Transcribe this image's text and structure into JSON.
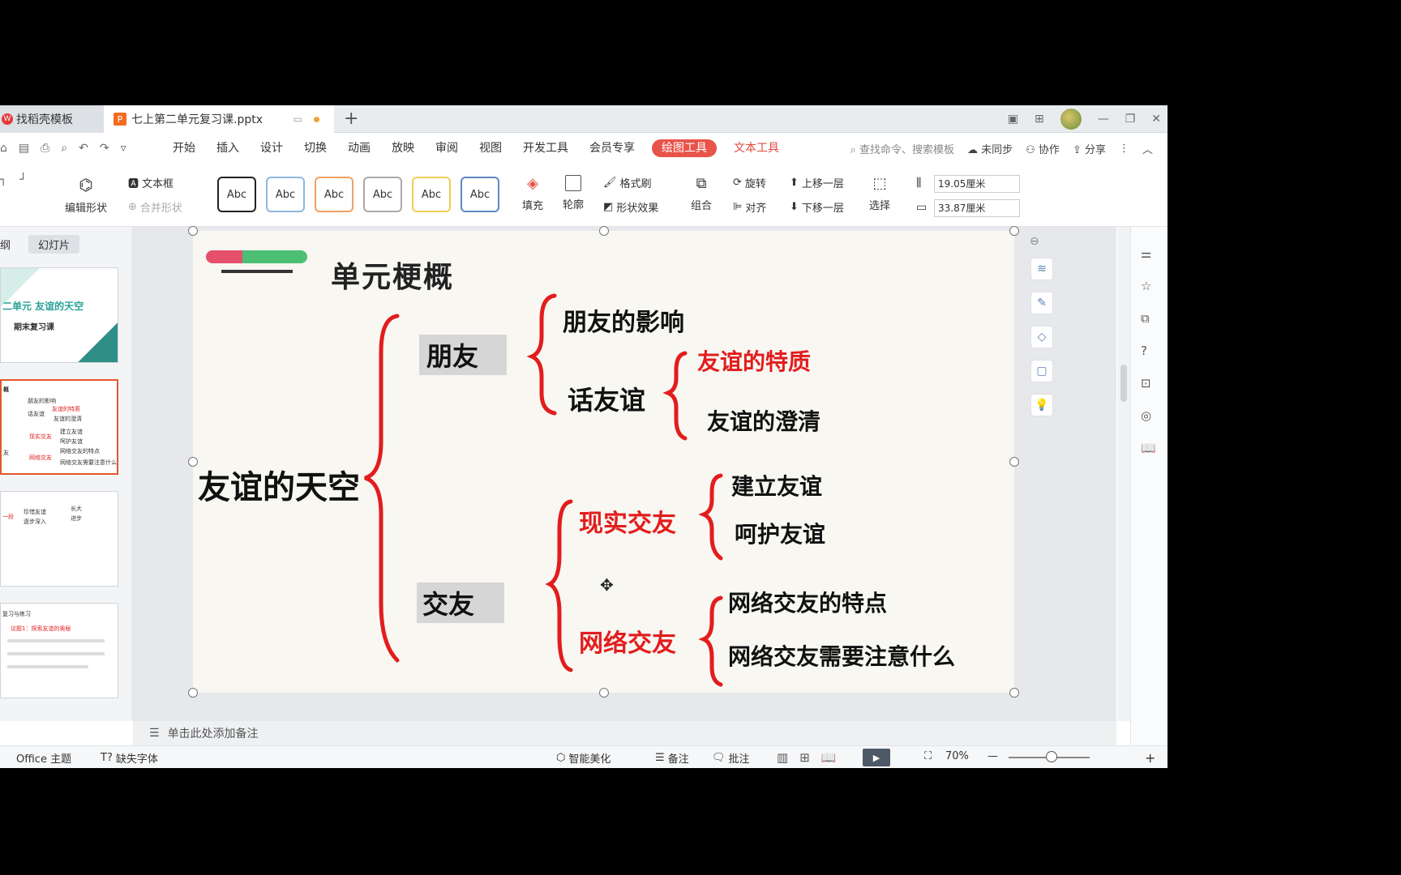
{
  "tabs": {
    "inactive_label": "找稻壳模板",
    "active_label": "七上第二单元复习课.pptx",
    "new_tab": "+"
  },
  "menu": {
    "items": [
      "开始",
      "插入",
      "设计",
      "切换",
      "动画",
      "放映",
      "审阅",
      "视图",
      "开发工具",
      "会员专享"
    ],
    "drawing_tools": "绘图工具",
    "text_tools": "文本工具",
    "search": "查找命令、搜索模板",
    "sync": "未同步",
    "collab": "协作",
    "share": "分享"
  },
  "ribbon": {
    "edit_shape": "编辑形状",
    "text_box": "文本框",
    "merge_shape": "合并形状",
    "style_samples": [
      "Abc",
      "Abc",
      "Abc",
      "Abc",
      "Abc",
      "Abc"
    ],
    "fill": "填充",
    "outline": "轮廓",
    "format_painter": "格式刷",
    "shape_effects": "形状效果",
    "group": "组合",
    "rotate": "旋转",
    "align": "对齐",
    "bring_forward": "上移一层",
    "send_backward": "下移一层",
    "select": "选择",
    "height_value": "19.05厘米",
    "width_value": "33.87厘米"
  },
  "left_panel": {
    "outline_tab": "纲",
    "slides_tab": "幻灯片",
    "thumb1_title": "二单元 友谊的天空",
    "thumb1_sub": "期末复习课",
    "thumb2_lines": [
      "概",
      "朋友的影响",
      "友谊的特质",
      "话友谊",
      "友谊的澄清",
      "友",
      "建立友谊",
      "现实交友",
      "呵护友谊",
      "网络交友的特点",
      "网络交友",
      "网络交友需要注意什么"
    ],
    "thumb3_lines": [
      "珍惜友谊",
      "逐步深入",
      "一段",
      "长大",
      "进步"
    ],
    "thumb4_lines": [
      "议题1：探索友谊的奥秘",
      "复习与练习"
    ],
    "add_slide": "+"
  },
  "slide": {
    "title": "单元梗概",
    "root": "友谊的天空",
    "branch1": "朋友",
    "branch1_child1": "朋友的影响",
    "branch1_child2": "话友谊",
    "branch1_child2_a": "友谊的特质",
    "branch1_child2_b": "友谊的澄清",
    "branch2": "交友",
    "branch2_child1": "现实交友",
    "branch2_child1_a": "建立友谊",
    "branch2_child1_b": "呵护友谊",
    "branch2_child2": "网络交友",
    "branch2_child2_a": "网络交友的特点",
    "branch2_child2_b": "网络交友需要注意什么"
  },
  "notes": {
    "placeholder": "单击此处添加备注"
  },
  "status": {
    "theme": "Office 主题",
    "missing_font": "缺失字体",
    "beautify": "智能美化",
    "notes": "备注",
    "comments": "批注",
    "zoom": "70%"
  },
  "colors": {
    "accent_red": "#e21d1d",
    "drawing_tools_bg": "#e8534a",
    "selected_thumb_border": "#e4572e"
  }
}
